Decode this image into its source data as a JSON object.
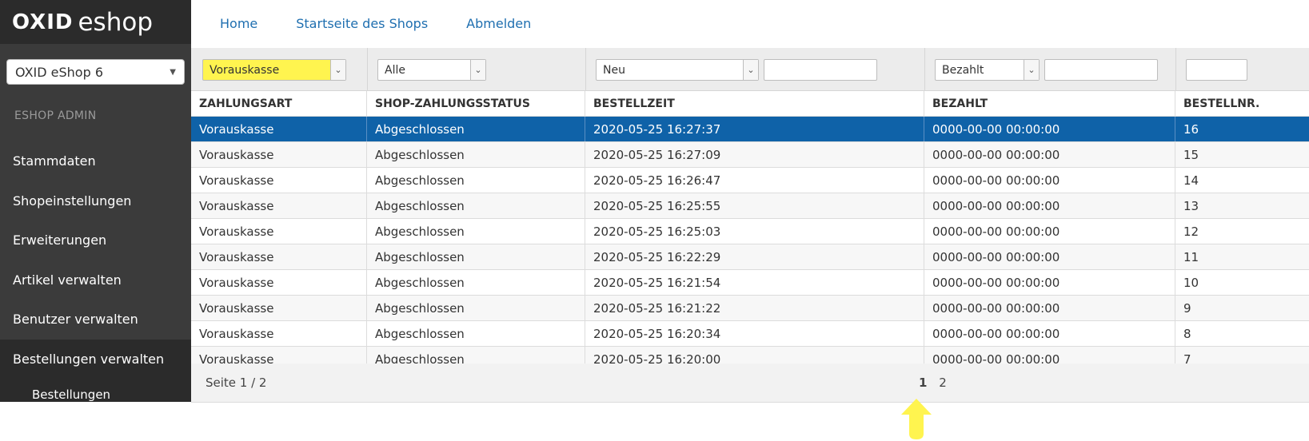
{
  "brand": {
    "logo_bold": "OXID",
    "logo_light": "eshop"
  },
  "shop_select": {
    "value": "OXID eShop 6"
  },
  "sidebar": {
    "section_title": "ESHOP ADMIN",
    "items": [
      {
        "label": "Stammdaten"
      },
      {
        "label": "Shopeinstellungen"
      },
      {
        "label": "Erweiterungen"
      },
      {
        "label": "Artikel verwalten"
      },
      {
        "label": "Benutzer verwalten"
      },
      {
        "label": "Bestellungen verwalten"
      }
    ],
    "sub_item": "Bestellungen"
  },
  "topnav": {
    "home": "Home",
    "shop_start": "Startseite des Shops",
    "logout": "Abmelden"
  },
  "filters": {
    "payment": "Vorauskasse",
    "status": "Alle",
    "order_state": "Neu",
    "paid": "Bezahlt"
  },
  "table": {
    "headers": [
      "ZAHLUNGSART",
      "SHOP-ZAHLUNGSSTATUS",
      "BESTELLZEIT",
      "BEZAHLT",
      "BESTELLNR."
    ],
    "rows": [
      [
        "Vorauskasse",
        "Abgeschlossen",
        "2020-05-25 16:27:37",
        "0000-00-00 00:00:00",
        "16"
      ],
      [
        "Vorauskasse",
        "Abgeschlossen",
        "2020-05-25 16:27:09",
        "0000-00-00 00:00:00",
        "15"
      ],
      [
        "Vorauskasse",
        "Abgeschlossen",
        "2020-05-25 16:26:47",
        "0000-00-00 00:00:00",
        "14"
      ],
      [
        "Vorauskasse",
        "Abgeschlossen",
        "2020-05-25 16:25:55",
        "0000-00-00 00:00:00",
        "13"
      ],
      [
        "Vorauskasse",
        "Abgeschlossen",
        "2020-05-25 16:25:03",
        "0000-00-00 00:00:00",
        "12"
      ],
      [
        "Vorauskasse",
        "Abgeschlossen",
        "2020-05-25 16:22:29",
        "0000-00-00 00:00:00",
        "11"
      ],
      [
        "Vorauskasse",
        "Abgeschlossen",
        "2020-05-25 16:21:54",
        "0000-00-00 00:00:00",
        "10"
      ],
      [
        "Vorauskasse",
        "Abgeschlossen",
        "2020-05-25 16:21:22",
        "0000-00-00 00:00:00",
        "9"
      ],
      [
        "Vorauskasse",
        "Abgeschlossen",
        "2020-05-25 16:20:34",
        "0000-00-00 00:00:00",
        "8"
      ],
      [
        "Vorauskasse",
        "Abgeschlossen",
        "2020-05-25 16:20:00",
        "0000-00-00 00:00:00",
        "7"
      ]
    ]
  },
  "pager": {
    "label": "Seite 1 / 2",
    "pages": [
      "1",
      "2"
    ]
  },
  "colors": {
    "selected_row": "#0f62a8",
    "highlight": "#fff44f",
    "link": "#1f6fb0",
    "sidebar": "#3b3b3b"
  }
}
